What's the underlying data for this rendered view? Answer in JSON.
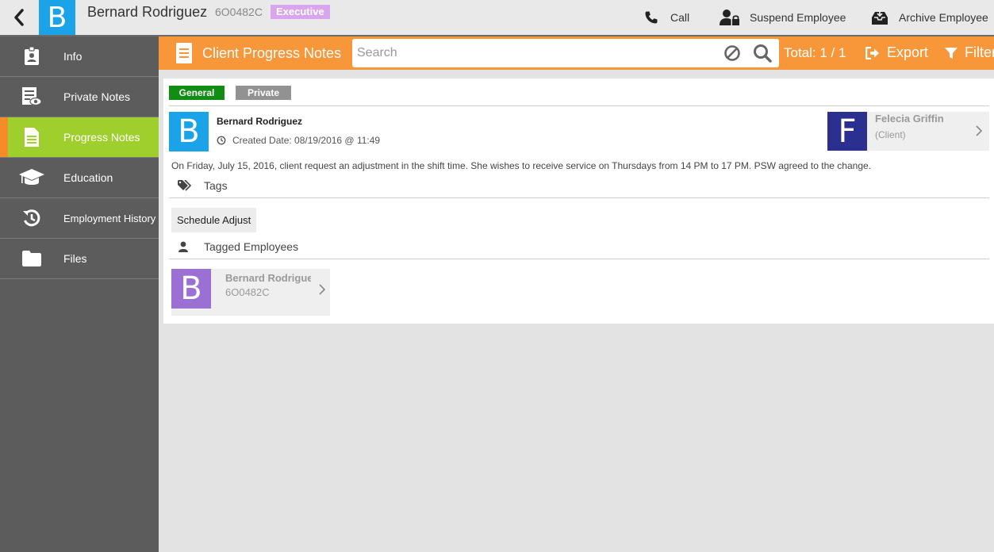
{
  "header": {
    "avatar_letter": "B",
    "employee_name": "Bernard Rodriguez",
    "employee_code": "6O0482C",
    "badge": "Executive",
    "actions": {
      "call": "Call",
      "suspend": "Suspend Employee",
      "archive": "Archive Employee"
    }
  },
  "sidebar": {
    "items": [
      {
        "label": "Info",
        "icon": "id-badge-icon"
      },
      {
        "label": "Private Notes",
        "icon": "private-notes-icon"
      },
      {
        "label": "Progress Notes",
        "icon": "document-icon",
        "active": true
      },
      {
        "label": "Education",
        "icon": "graduation-cap-icon"
      },
      {
        "label": "Employment History",
        "icon": "history-icon"
      },
      {
        "label": "Files",
        "icon": "folder-icon"
      }
    ]
  },
  "toolbar": {
    "title": "Client Progress Notes",
    "search_placeholder": "Search",
    "search_value": "",
    "total": "Total: 1 / 1",
    "export_label": "Export",
    "filter_label": "Filter"
  },
  "note": {
    "tabs": {
      "general": "General",
      "private": "Private"
    },
    "author_letter": "B",
    "author": "Bernard Rodriguez",
    "created": "Created Date: 08/19/2016 @ 11:49",
    "client": {
      "letter": "F",
      "name": "Felecia Griffin",
      "role": "(Client)"
    },
    "text": "On Friday, July 15, 2016, client request an adjustment in the shift time. She wishes to receive service on Thursdays from 14 PM to 17 PM. PSW agreed to the change.",
    "tags_label": "Tags",
    "tags": [
      "Schedule Adjust"
    ],
    "tagged_employees_label": "Tagged Employees",
    "tagged_employees": [
      {
        "letter": "B",
        "name": "Bernard Rodriguez",
        "code": "6O0482C"
      }
    ]
  },
  "colors": {
    "accent": "#f8973a",
    "active_nav": "#9fcf2d",
    "sidebar": "#5c5c5c",
    "avatar_blue": "#1aa3e8",
    "avatar_navy": "#2b2f8f",
    "avatar_purple": "#9b6fd3",
    "badge": "#d9a6ee",
    "general_tab": "#118d13"
  }
}
